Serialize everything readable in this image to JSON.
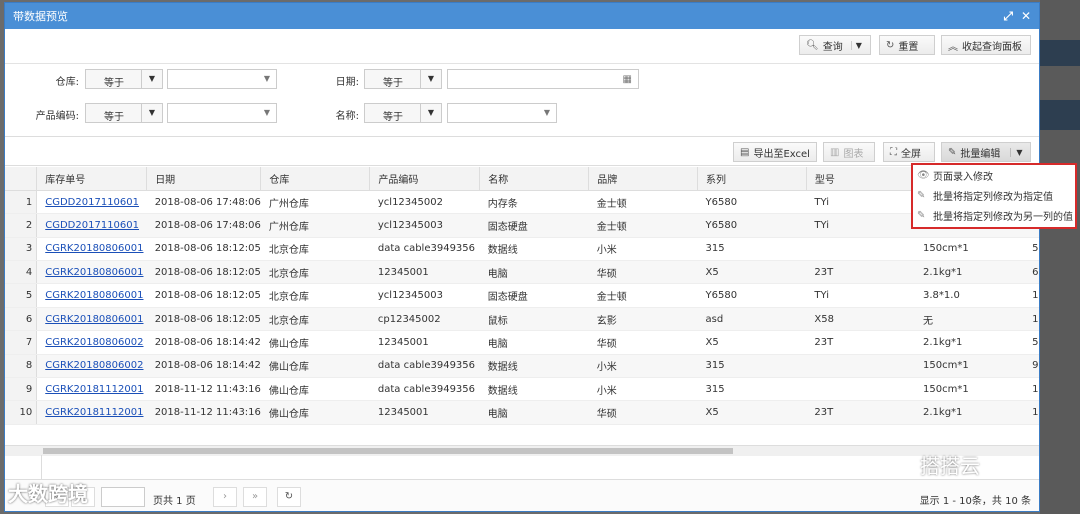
{
  "window": {
    "title": "带数据预览"
  },
  "toolbar": {
    "query": "查询",
    "reset": "重置",
    "collapse": "收起查询面板"
  },
  "filters": {
    "warehouse": {
      "label": "仓库:",
      "op": "等于"
    },
    "date": {
      "label": "日期:",
      "op": "等于"
    },
    "product_code": {
      "label": "产品编码:",
      "op": "等于"
    },
    "name": {
      "label": "名称:",
      "op": "等于"
    }
  },
  "grid_toolbar": {
    "export": "导出至Excel",
    "chart": "图表",
    "fullscreen": "全屏",
    "batch_edit": "批量编辑"
  },
  "batch_menu": [
    "页面录入修改",
    "批量将指定列修改为指定值",
    "批量将指定列修改为另一列的值"
  ],
  "table": {
    "columns": [
      "库存单号",
      "日期",
      "仓库",
      "产品编码",
      "名称",
      "品牌",
      "系列",
      "型号",
      ""
    ],
    "rows": [
      {
        "n": "1",
        "c": [
          "CGDD2017110601",
          "2018-08-06 17:48:06",
          "广州仓库",
          "ycl12345002",
          "内存条",
          "金士顿",
          "Y6580",
          "TYi",
          "",
          ""
        ]
      },
      {
        "n": "2",
        "c": [
          "CGDD2017110601",
          "2018-08-06 17:48:06",
          "广州仓库",
          "ycl12345003",
          "固态硬盘",
          "金士顿",
          "Y6580",
          "TYi",
          "",
          ""
        ]
      },
      {
        "n": "3",
        "c": [
          "CGRK20180806001",
          "2018-08-06 18:12:05",
          "北京仓库",
          "data cable3949356",
          "数据线",
          "小米",
          "315",
          "",
          "150cm*1",
          "5"
        ]
      },
      {
        "n": "4",
        "c": [
          "CGRK20180806001",
          "2018-08-06 18:12:05",
          "北京仓库",
          "12345001",
          "电脑",
          "华硕",
          "X5",
          "23T",
          "2.1kg*1",
          "6"
        ]
      },
      {
        "n": "5",
        "c": [
          "CGRK20180806001",
          "2018-08-06 18:12:05",
          "北京仓库",
          "ycl12345003",
          "固态硬盘",
          "金士顿",
          "Y6580",
          "TYi",
          "3.8*1.0",
          "1"
        ]
      },
      {
        "n": "6",
        "c": [
          "CGRK20180806001",
          "2018-08-06 18:12:05",
          "北京仓库",
          "cp12345002",
          "鼠标",
          "玄影",
          "asd",
          "X58",
          "无",
          "1"
        ]
      },
      {
        "n": "7",
        "c": [
          "CGRK20180806002",
          "2018-08-06 18:14:42",
          "佛山仓库",
          "12345001",
          "电脑",
          "华硕",
          "X5",
          "23T",
          "2.1kg*1",
          "5"
        ]
      },
      {
        "n": "8",
        "c": [
          "CGRK20180806002",
          "2018-08-06 18:14:42",
          "佛山仓库",
          "data cable3949356",
          "数据线",
          "小米",
          "315",
          "",
          "150cm*1",
          "9"
        ]
      },
      {
        "n": "9",
        "c": [
          "CGRK20181112001",
          "2018-11-12 11:43:16",
          "佛山仓库",
          "data cable3949356",
          "数据线",
          "小米",
          "315",
          "",
          "150cm*1",
          "1"
        ]
      },
      {
        "n": "10",
        "c": [
          "CGRK20181112001",
          "2018-11-12 11:43:16",
          "佛山仓库",
          "12345001",
          "电脑",
          "华硕",
          "X5",
          "23T",
          "2.1kg*1",
          "1"
        ]
      }
    ]
  },
  "pager": {
    "total_pages": "页共 1 页",
    "summary": "显示 1 - 10条，共 10 条"
  },
  "watermarks": {
    "left": "大数跨境",
    "right": "搭搭云"
  }
}
